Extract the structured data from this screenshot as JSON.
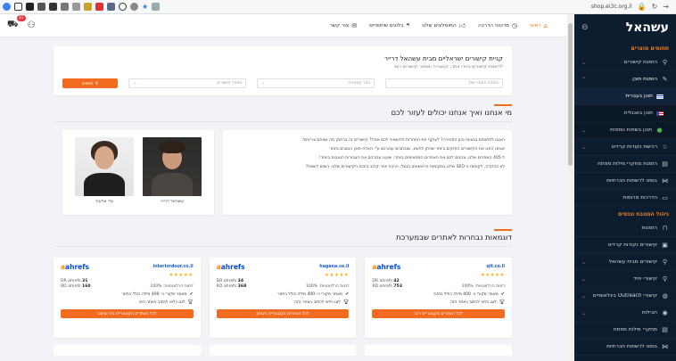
{
  "browser": {
    "url": "shop.ei3c.org.il",
    "bookmark_icons": [
      "globe-icon",
      "square-icon",
      "flag-icon",
      "feather-icon",
      "extension-icon",
      "grid-icon",
      "link-icon",
      "gear-icon",
      "red-badge-icon",
      "save-icon",
      "ring-icon",
      "sync-icon",
      "star-icon",
      "puzzle-icon"
    ]
  },
  "sidebar": {
    "logo": "עשהאל",
    "sections": [
      {
        "title": "תחומים מוצרים"
      },
      {
        "title": "ניהול המטבח ונכסים"
      }
    ],
    "items": [
      {
        "label": "הזמנת קישורים",
        "icon": "link-icon",
        "chevron": "⌄"
      },
      {
        "label": "הזמנת תוכן",
        "icon": "pen-icon",
        "chevron": "⌃"
      },
      {
        "label": "תוכן בעברית",
        "icon": "flag-il-icon",
        "chevron": ""
      },
      {
        "label": "תוכן באנגלית",
        "icon": "flag-us-icon",
        "chevron": ""
      },
      {
        "label": "תוכן בשפות נוספות",
        "icon": "globe-icon",
        "chevron": "⌄"
      },
      {
        "label": "רכישת נקודות קרדיט",
        "icon": "star-icon",
        "chevron": "⌄"
      },
      {
        "label": "הזמנת מחקרי מילות מפתח",
        "icon": "doc-icon",
        "chevron": ""
      },
      {
        "label": "בוסט לרשתות חברתיות",
        "icon": "share-icon",
        "chevron": ""
      },
      {
        "label": "הדרכות מרוסות",
        "icon": "video-icon",
        "chevron": ""
      },
      {
        "label": "ניהול המטבח ונכסים",
        "icon": "",
        "chevron": ""
      },
      {
        "label": "הזמנות",
        "icon": "bag-icon",
        "chevron": ""
      },
      {
        "label": "קישורים נקודות קרדיט",
        "icon": "coin-icon",
        "chevron": ""
      },
      {
        "label": "קישורים מבית עשהאל",
        "icon": "link-icon",
        "chevron": "⌄"
      },
      {
        "label": "קישורי יחיד",
        "icon": "link-icon",
        "chevron": "⌄"
      },
      {
        "label": "קישורי Outreach בינלאומיים",
        "icon": "globe-icon",
        "chevron": "⌄"
      },
      {
        "label": "חבילות",
        "icon": "box-icon",
        "chevron": "⌄"
      },
      {
        "label": "מחקרי מילות מפתח",
        "icon": "doc-icon",
        "chevron": ""
      },
      {
        "label": "בוסט לרשתות חברתיות",
        "icon": "share-icon",
        "chevron": ""
      }
    ]
  },
  "topbar": {
    "nav": [
      {
        "label": "ראשי",
        "icon": "home-icon"
      },
      {
        "label": "סרטוני הדרכה",
        "icon": "clock-icon"
      },
      {
        "label": "המומלצים שלנו",
        "icon": "thumb-icon"
      },
      {
        "label": "בלוגים שיתופיים",
        "icon": "quote-icon"
      },
      {
        "label": "צור קשר",
        "icon": "mail-icon"
      }
    ],
    "cart_count": "31"
  },
  "search": {
    "title": "קניית קישורים ישראליים מבית עשהאל דרייר",
    "subtitle": "להזמנת קישורים בחרו אתר, קטגוריה ומספר קישורים רצוי",
    "fields": [
      {
        "placeholder": "כתובת האתר שלך"
      },
      {
        "placeholder": "בחר קטגוריה"
      },
      {
        "placeholder": "מספר קישורים"
      }
    ],
    "button": "חיפוש"
  },
  "about": {
    "heading": "מי אנחנו ואיך אנחנו יכולים לעזור לכם",
    "paragraphs": [
      "הצגנו לתחומים בגאווה נכון המחירה? לעוקף את התחרות ולהשאיר לכם אוכל? קישורים זה ברחוק מה שאתם צריכים!",
      "אנחנו התנו את הקישורים החזקים ביותר שניתן להשיג, שנכתבים עבורכם ע\"י האלה-תוכן הטובים ביותר",
      "ל-405 האתרים שלנו, ונהנים לכם את האתרים המתאימים ביותר, שיענו עבורכם את הצבורות הטובות ביותר!",
      "לא בהקדה, לקוחות ה-SEO שלנו במקומות הראשונים בגוגל, הרבה יותר קרוב בזכות הקישורים שלנו. רוצים לשמח?"
    ],
    "team": [
      {
        "name": "עשהאל דרייר"
      },
      {
        "name": "עדי אלעזר"
      }
    ]
  },
  "examples": {
    "heading": "דוגמאות נבחרות לאתרים שבמערכת",
    "cards": [
      {
        "domain": "qit.co.il",
        "dr": "42",
        "rd": "753",
        "relevance": "דמות הרלוונטיות: 100%",
        "feature1": "מאמר מקורי כ- 400 מילה כולל בחזור",
        "feature2": "לוגו כלאי לכתוב באתר הזה",
        "button": "לכל האתרים מקטגוריית רכב"
      },
      {
        "domain": "hagana.co.il",
        "dr": "34",
        "rd": "368",
        "relevance": "דמות הרלוונטיות: 100%",
        "feature1": "מאמר מקורי כ- 400 מילה כולל בחזור",
        "feature2": "לוגו כלאי לכתוב באתר הזה",
        "button": "לכל האתרים מקטגוריית ביטחון"
      },
      {
        "domain": "interiordoor.co.il",
        "dr": "31",
        "rd": "160",
        "relevance": "דמות הרלוונטיות: 100%",
        "feature1": "מאמר מקורי כ- 400 מילה כולל בחזור",
        "feature2": "לוגו כלאי לכתוב באתר הזה",
        "button": "לכל האתרים מקטגוריית בית ועיצוב"
      }
    ],
    "labels": {
      "dr": "DR ahrefs",
      "rd": "RD ahrefs",
      "brand": "ahrefs",
      "stars": "★★★★★"
    }
  },
  "colors": {
    "accent": "#f26b21",
    "sidebar": "#0c1d2f",
    "link": "#1a5dd6"
  }
}
